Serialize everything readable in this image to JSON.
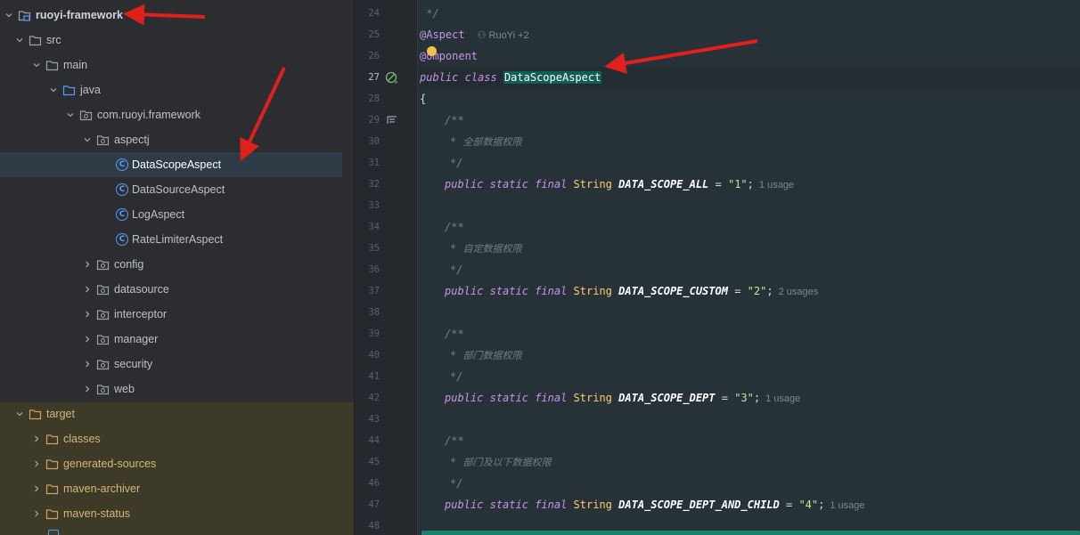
{
  "tree": {
    "module": "ruoyi-framework",
    "src": "src",
    "main": "main",
    "java": "java",
    "package": "com.ruoyi.framework",
    "aspectj": "aspectj",
    "classes": [
      "DataScopeAspect",
      "DataSourceAspect",
      "LogAspect",
      "RateLimiterAspect"
    ],
    "folders": [
      "config",
      "datasource",
      "interceptor",
      "manager",
      "security",
      "web"
    ],
    "target": "target",
    "target_items": [
      "classes",
      "generated-sources",
      "maven-archiver",
      "maven-status"
    ]
  },
  "editor": {
    "line_numbers": [
      "24",
      "25",
      "26",
      "27",
      "28",
      "29",
      "30",
      "31",
      "32",
      "33",
      "34",
      "35",
      "36",
      "37",
      "38",
      "39",
      "40",
      "41",
      "42",
      "43",
      "44",
      "45",
      "46",
      "47",
      "48"
    ],
    "current_line": "27",
    "code": {
      "l24": " */",
      "annotation_aspect": "@Aspect",
      "author_hint": "RuoYi +2",
      "annotation_component_at": "@",
      "annotation_component_rest": "omponent",
      "kw_public": "public",
      "kw_class": "class",
      "class_name": "DataScopeAspect",
      "brace_open": "{",
      "doc_open": "/**",
      "doc_close": "*/",
      "doc_star": "*",
      "kw_static": "static",
      "kw_final": "final",
      "type_string": "String",
      "comment_all": "全部数据权限",
      "comment_custom": "自定数据权限",
      "comment_dept": "部门数据权限",
      "comment_dept_child": "部门及以下数据权限",
      "const_all": "DATA_SCOPE_ALL",
      "const_custom": "DATA_SCOPE_CUSTOM",
      "const_dept": "DATA_SCOPE_DEPT",
      "const_dept_child": "DATA_SCOPE_DEPT_AND_CHILD",
      "val_all": "\"1\"",
      "val_custom": "\"2\"",
      "val_dept": "\"3\"",
      "val_dept_child": "\"4\"",
      "eq": " = ",
      "semi": ";",
      "usage_all": "1 usage",
      "usage_custom": "2 usages",
      "usage_dept": "1 usage",
      "usage_dept_child": "1 usage"
    }
  },
  "colors": {
    "tree_bg": "#2b2d30",
    "editor_bg": "#263238",
    "target_highlight": "#3d3a27",
    "class_highlight": "#0f5e57",
    "arrow": "#e0201b"
  },
  "icons": [
    "chevron-down-icon",
    "chevron-right-icon",
    "module-folder-icon",
    "folder-icon",
    "package-icon",
    "class-icon",
    "lightbulb-icon",
    "implement-gutter-icon",
    "structure-gutter-icon",
    "person-icon"
  ]
}
